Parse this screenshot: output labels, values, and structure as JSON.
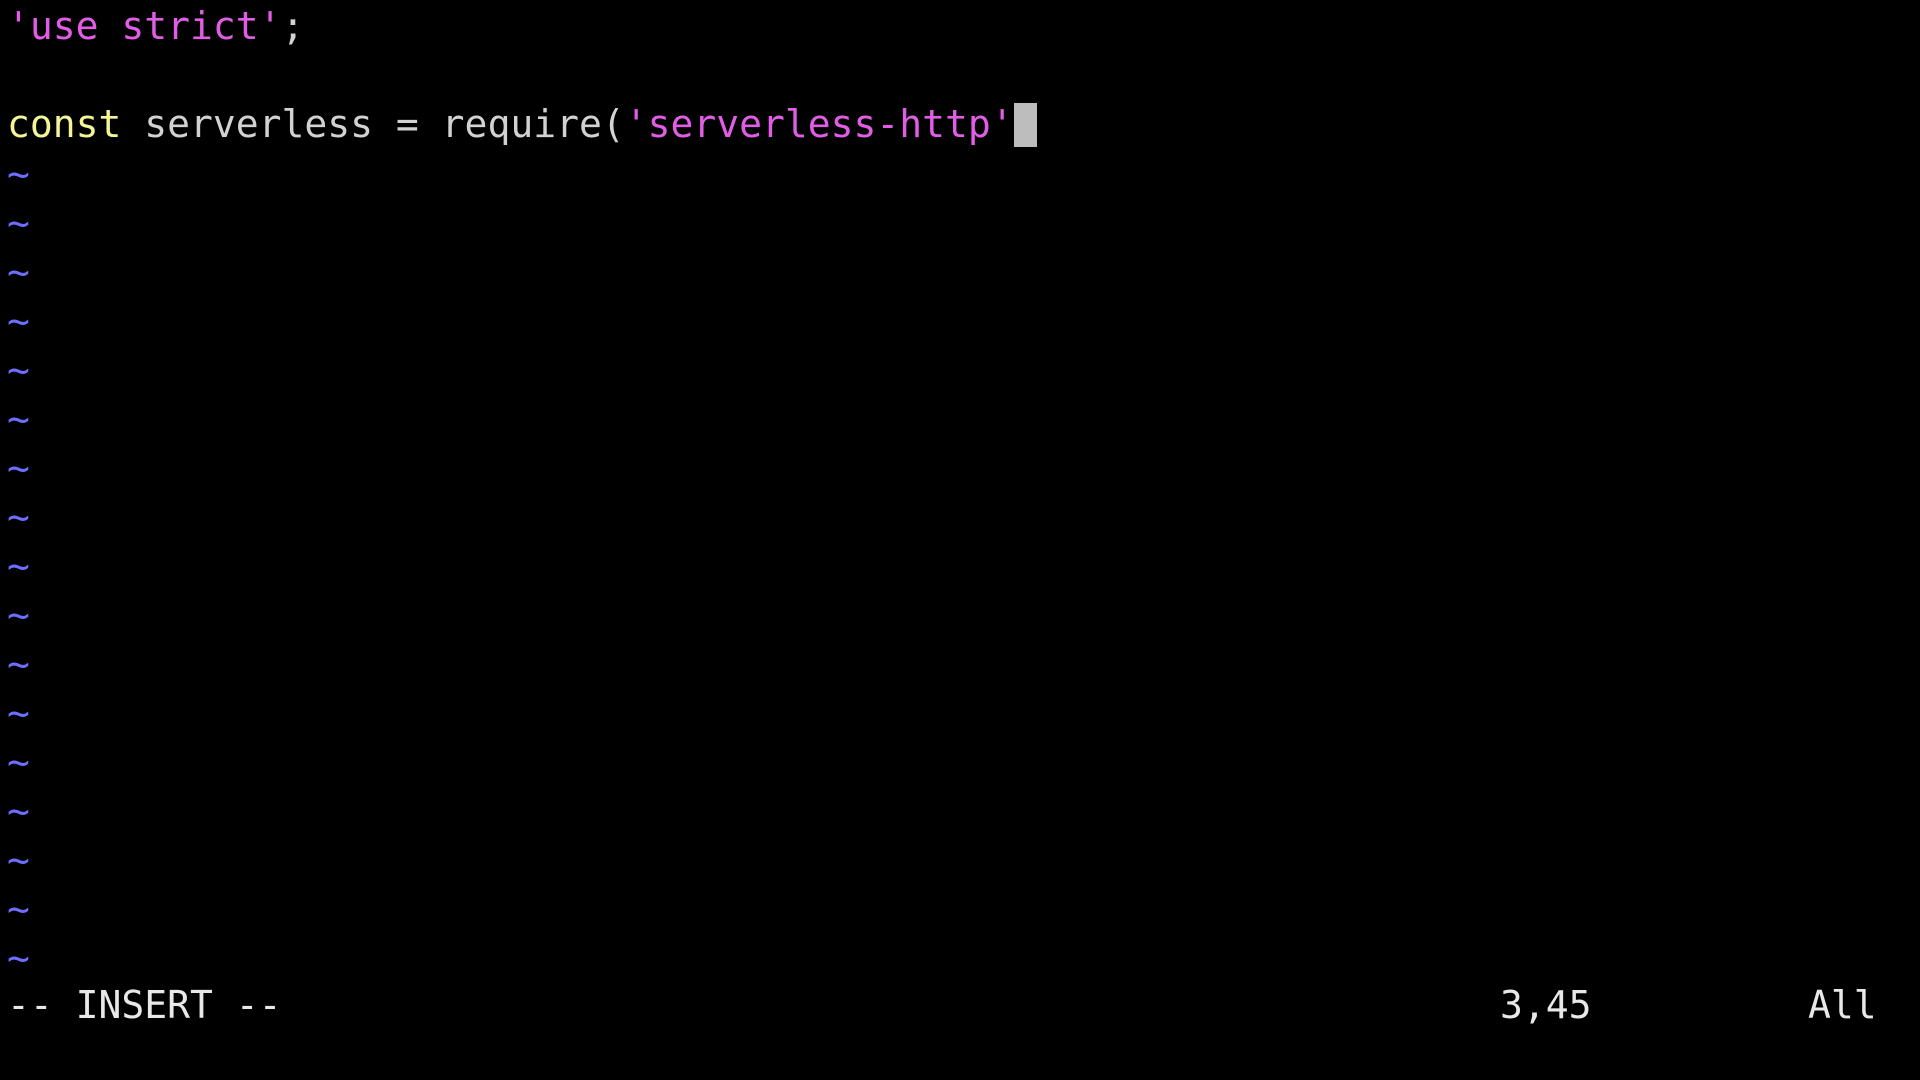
{
  "editor": {
    "lines": [
      {
        "string_literal": "'use strict'",
        "punctuation": ";"
      },
      {
        "text": ""
      },
      {
        "keyword": "const",
        "identifier_part": " serverless = require(",
        "string_literal": "'serverless-http'"
      }
    ],
    "empty_line_marker": "~",
    "colors": {
      "background": "#000000",
      "string": "#e25de6",
      "keyword": "#f3f596",
      "text": "#d2d2d2",
      "tilde": "#6e6eff",
      "cursor": "#bdbdbd"
    }
  },
  "statusline": {
    "mode": "-- INSERT --",
    "cursor_position": "3,45",
    "scroll_position": "All"
  }
}
